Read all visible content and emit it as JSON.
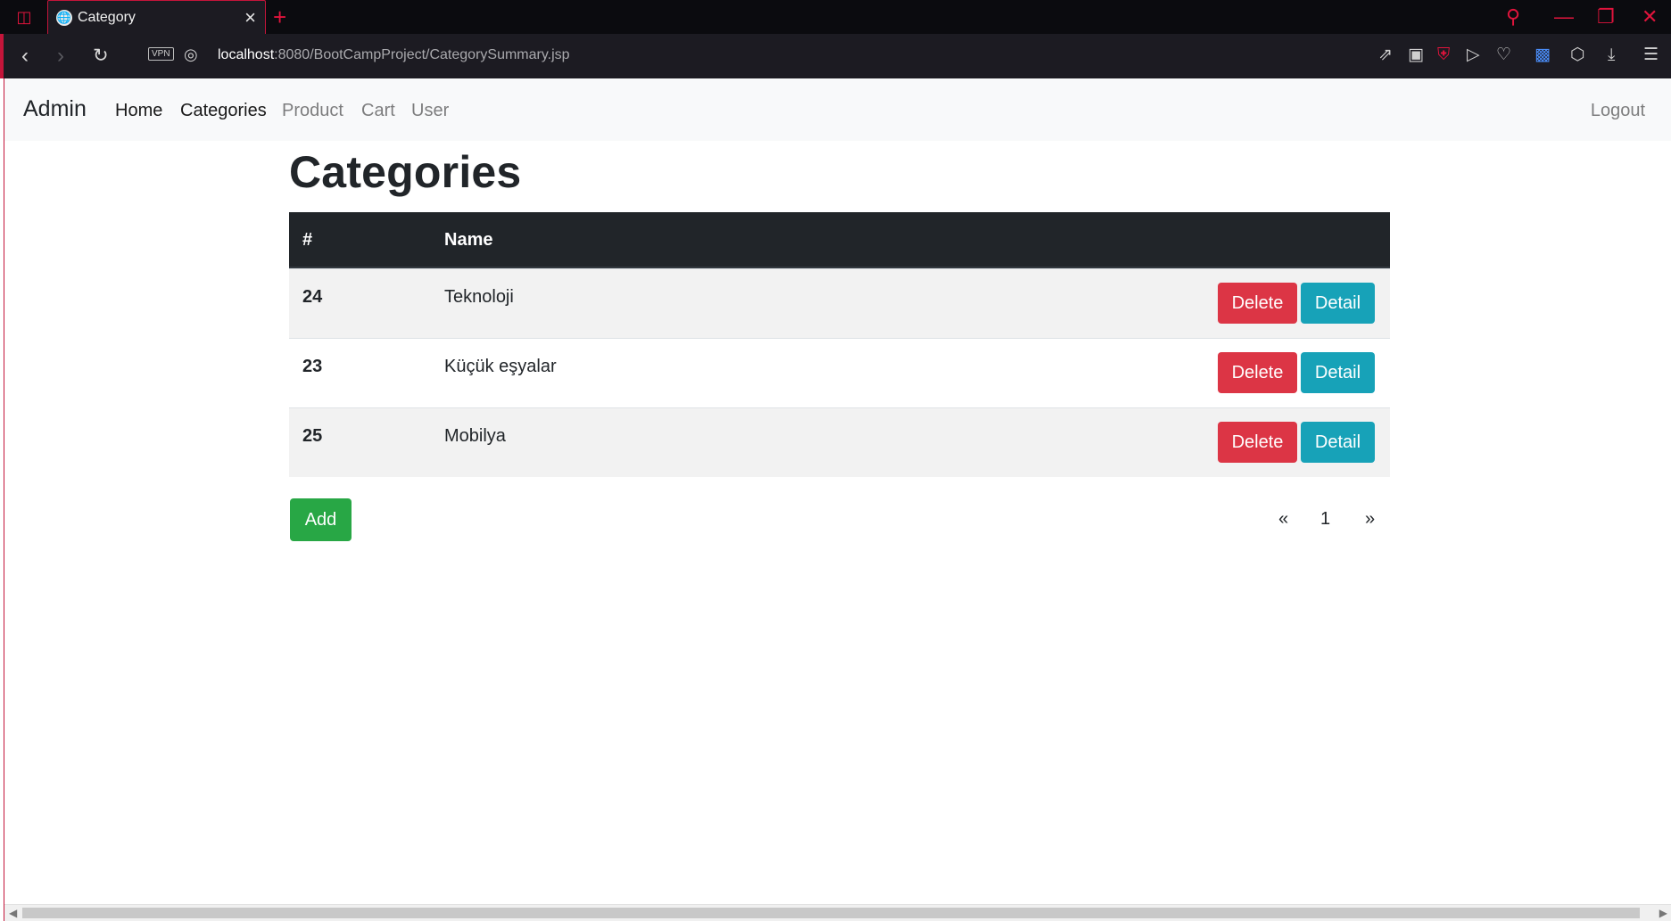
{
  "browser": {
    "tab_title": "Category",
    "tab_close": "×",
    "new_tab": "+",
    "vpn_label": "VPN",
    "url_host": "localhost",
    "url_rest": ":8080/BootCampProject/CategorySummary.jsp",
    "icons": [
      "opera-menu-icon",
      "globe-icon",
      "search-icon",
      "minimize-icon",
      "restore-icon",
      "close-window-icon",
      "back-icon",
      "forward-icon",
      "reload-icon",
      "share-icon",
      "camera-icon",
      "shield-icon",
      "send-icon",
      "heart-icon",
      "translate-icon",
      "cube-icon",
      "download-icon",
      "settings-icon"
    ]
  },
  "navbar": {
    "brand": "Admin",
    "links": [
      "Home",
      "Categories",
      "Product",
      "Cart",
      "User"
    ],
    "logout": "Logout"
  },
  "page": {
    "title": "Categories"
  },
  "table": {
    "headers": [
      "#",
      "Name"
    ],
    "rows": [
      {
        "id": "24",
        "name": "Teknoloji",
        "delete": "Delete",
        "detail": "Detail"
      },
      {
        "id": "23",
        "name": "Küçük eşyalar",
        "delete": "Delete",
        "detail": "Detail"
      },
      {
        "id": "25",
        "name": "Mobilya",
        "delete": "Delete",
        "detail": "Detail"
      }
    ]
  },
  "actions": {
    "add": "Add"
  },
  "pagination": {
    "prev": "«",
    "page": "1",
    "next": "»"
  },
  "colors": {
    "danger": "#dc3545",
    "info": "#17a2b8",
    "success": "#28a745",
    "table_head": "#212529",
    "accent": "#e0143c"
  }
}
